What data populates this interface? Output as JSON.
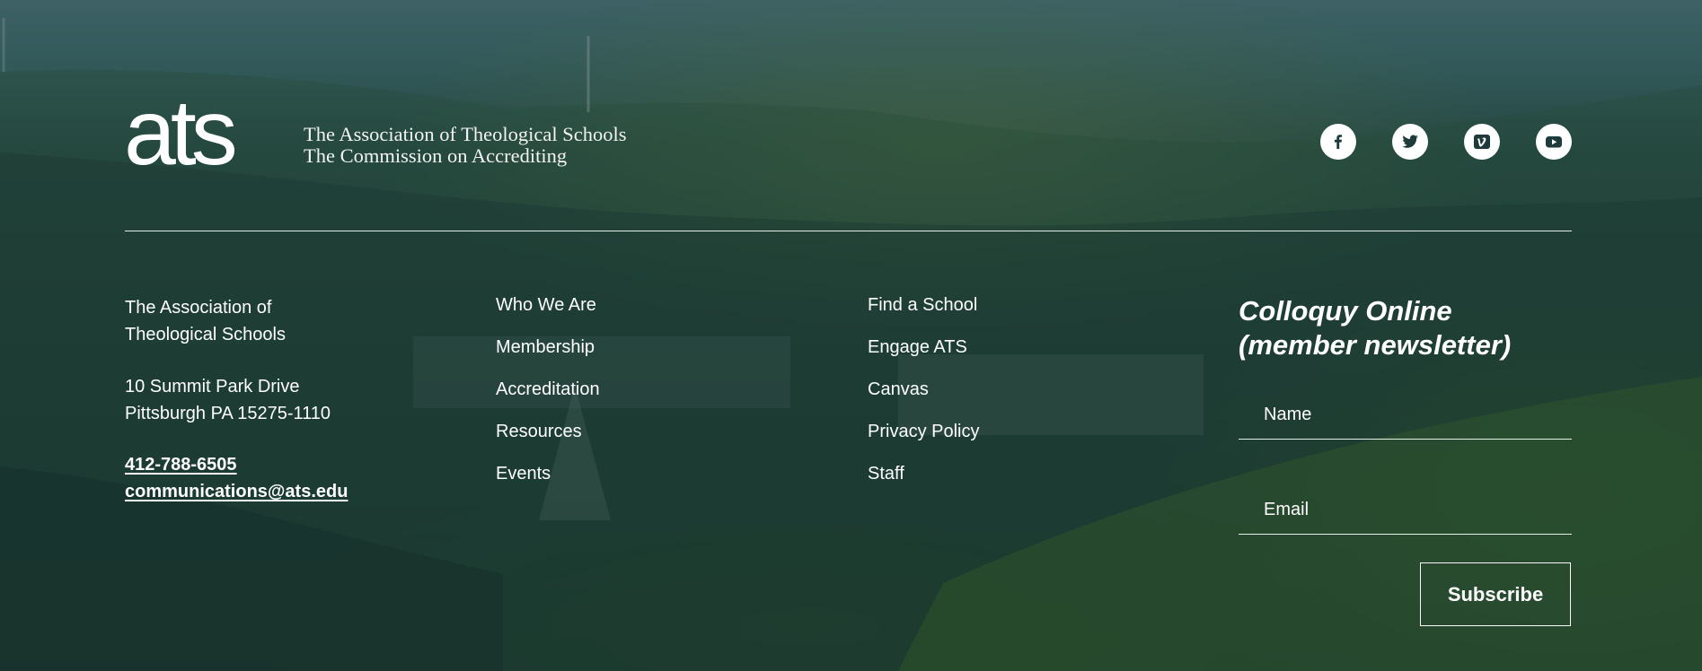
{
  "brand": {
    "mark": "ats",
    "line1": "The Association of Theological Schools",
    "line2": "The Commission on Accrediting"
  },
  "social": [
    {
      "icon": "facebook-icon"
    },
    {
      "icon": "twitter-icon"
    },
    {
      "icon": "vimeo-icon"
    },
    {
      "icon": "youtube-icon"
    }
  ],
  "address": {
    "org_line1": "The Association of",
    "org_line2": "Theological Schools",
    "street": "10 Summit Park Drive",
    "city": "Pittsburgh PA 15275-1110",
    "phone": "412-788-6505",
    "email": "communications@ats.edu"
  },
  "nav_col1": [
    "Who We Are",
    "Membership",
    "Accreditation",
    "Resources",
    "Events"
  ],
  "nav_col2": [
    "Find a School",
    "Engage ATS",
    "Canvas",
    "Privacy Policy",
    "Staff"
  ],
  "newsletter": {
    "title_line1": "Colloquy Online",
    "title_line2": "(member newsletter)",
    "name_placeholder": "Name",
    "email_placeholder": "Email",
    "subscribe_label": "Subscribe"
  },
  "colors": {
    "text": "#ffffff",
    "icon_fill": "#1f3a3a",
    "overlay": "#24453b"
  }
}
